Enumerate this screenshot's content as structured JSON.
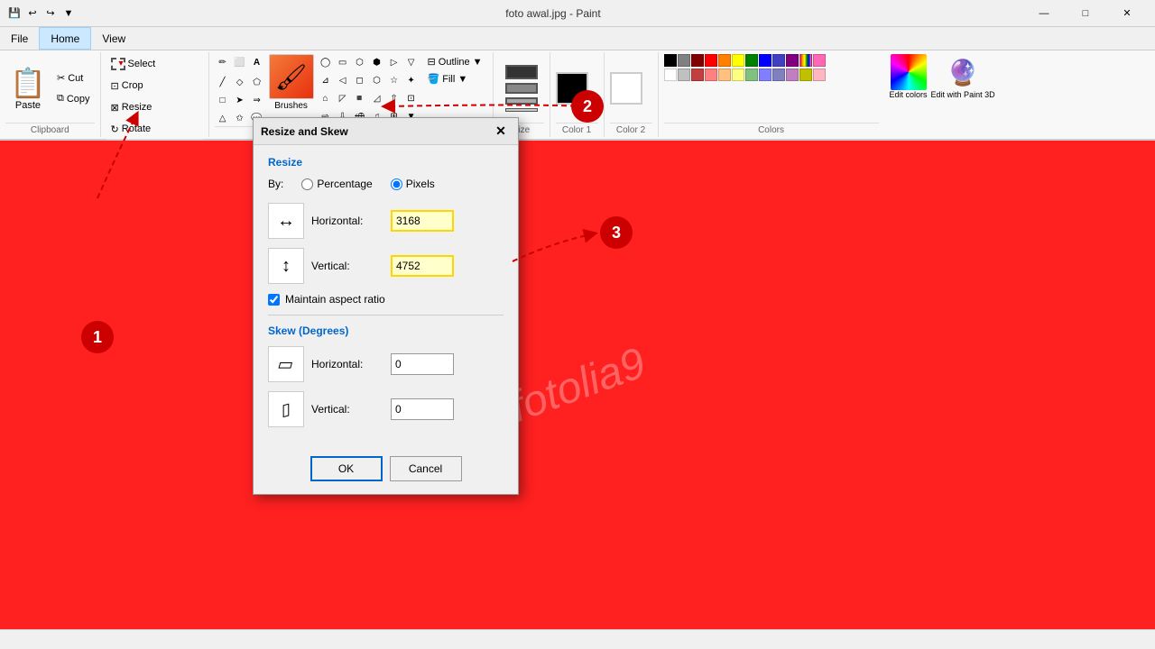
{
  "titleBar": {
    "title": "foto awal.jpg - Paint",
    "minimizeLabel": "—",
    "maximizeLabel": "□",
    "closeLabel": "✕"
  },
  "menuBar": {
    "items": [
      "File",
      "Home",
      "View"
    ]
  },
  "ribbon": {
    "clipboard": {
      "paste": "Paste",
      "cut": "Cut",
      "copy": "Copy"
    },
    "image": {
      "select": "Select",
      "crop": "Crop",
      "resize": "Resize",
      "rotate": "Rotate"
    },
    "tools": {
      "brushes": "Brushes",
      "outline": "Outline",
      "fill": "Fill"
    },
    "size": {
      "label": "Size"
    },
    "colors": {
      "color1": "Color 1",
      "color2": "Color 2",
      "editColors": "Edit colors",
      "editWithPaint3D": "Edit with Paint 3D"
    }
  },
  "dialog": {
    "title": "Resize and Skew",
    "sections": {
      "resize": "Resize",
      "by": "By:",
      "percentage": "Percentage",
      "pixels": "Pixels",
      "horizontal_label": "Horizontal:",
      "horizontal_value": "3168",
      "vertical_label": "Vertical:",
      "vertical_value": "4752",
      "maintain_aspect": "Maintain aspect ratio",
      "skew": "Skew (Degrees)",
      "skew_horizontal_label": "Horizontal:",
      "skew_horizontal_value": "0",
      "skew_vertical_label": "Vertical:",
      "skew_vertical_value": "0"
    },
    "buttons": {
      "ok": "OK",
      "cancel": "Cancel"
    }
  },
  "annotations": {
    "circle1": "1",
    "circle2": "2",
    "circle3": "3"
  },
  "statusBar": {
    "text": ""
  }
}
